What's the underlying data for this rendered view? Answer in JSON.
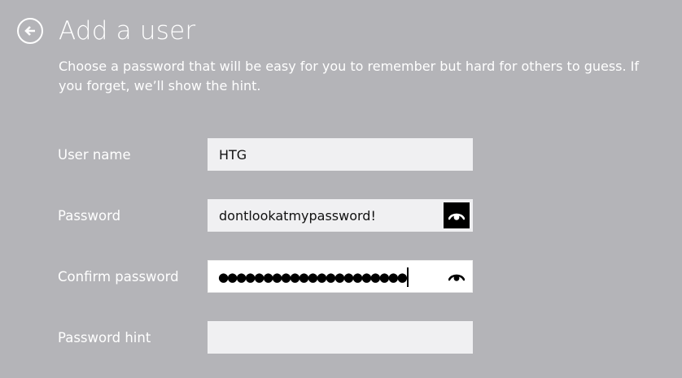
{
  "header": {
    "back_icon": "back-arrow-circle-icon",
    "title": "Add a user",
    "description": "Choose a password that will be easy for you to remember but hard for others to guess. If you forget, we’ll show the hint."
  },
  "form": {
    "username": {
      "label": "User name",
      "value": "HTG"
    },
    "password": {
      "label": "Password",
      "value": "dontlookatmypassword!",
      "reveal_icon": "eye-icon",
      "reveal_pressed": true
    },
    "confirm_password": {
      "label": "Confirm password",
      "masked_value": "●●●●●●●●●●●●●●●●●●●●●",
      "reveal_icon": "eye-icon"
    },
    "password_hint": {
      "label": "Password hint",
      "value": ""
    }
  },
  "colors": {
    "background": "#b4b4b8",
    "text": "#ffffff",
    "field_background": "#f0f0f2",
    "field_text": "#111111",
    "pressed_button": "#000000"
  }
}
